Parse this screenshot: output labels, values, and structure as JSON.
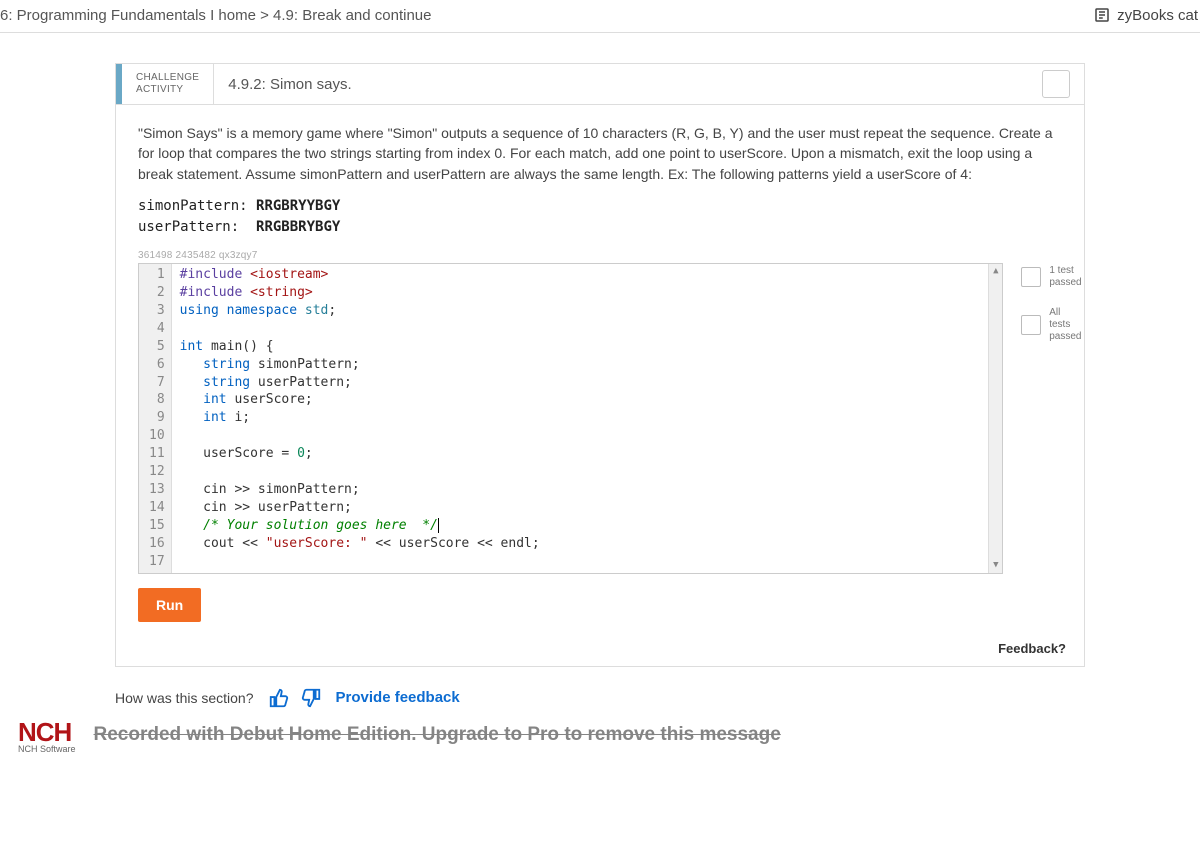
{
  "breadcrumb": "6: Programming Fundamentals I home > 4.9: Break and continue",
  "catalog_label": "zyBooks cat",
  "activity": {
    "label_line1": "CHALLENGE",
    "label_line2": "ACTIVITY",
    "title": "4.9.2: Simon says.",
    "description": "\"Simon Says\" is a memory game where \"Simon\" outputs a sequence of 10 characters (R, G, B, Y) and the user must repeat the sequence. Create a for loop that compares the two strings starting from index 0. For each match, add one point to userScore. Upon a mismatch, exit the loop using a break statement. Assume simonPattern and userPattern are always the same length. Ex: The following patterns yield a userScore of 4:",
    "pattern": {
      "simon_label": "simonPattern:",
      "simon_value": "RRGBRYYBGY",
      "user_label": "userPattern:",
      "user_value": "RRGBBRYBGY"
    },
    "code_id": "361498 2435482 qx3zqy7",
    "run_label": "Run",
    "feedback_label": "Feedback?"
  },
  "tests": {
    "t1": "1 test passed",
    "t2": "All tests passed"
  },
  "code_lines": [
    "#include <iostream>",
    "#include <string>",
    "using namespace std;",
    "",
    "int main() {",
    "   string simonPattern;",
    "   string userPattern;",
    "   int userScore;",
    "   int i;",
    "",
    "   userScore = 0;",
    "",
    "   cin >> simonPattern;",
    "   cin >> userPattern;",
    "   /* Your solution goes here  */",
    "   cout << \"userScore: \" << userScore << endl;",
    ""
  ],
  "section_feedback": {
    "question": "How was this section?",
    "provide": "Provide feedback"
  },
  "nch": {
    "logo": "NCH",
    "sub": "NCH Software",
    "watermark": "Recorded with Debut Home Edition. Upgrade to Pro to remove this message"
  }
}
